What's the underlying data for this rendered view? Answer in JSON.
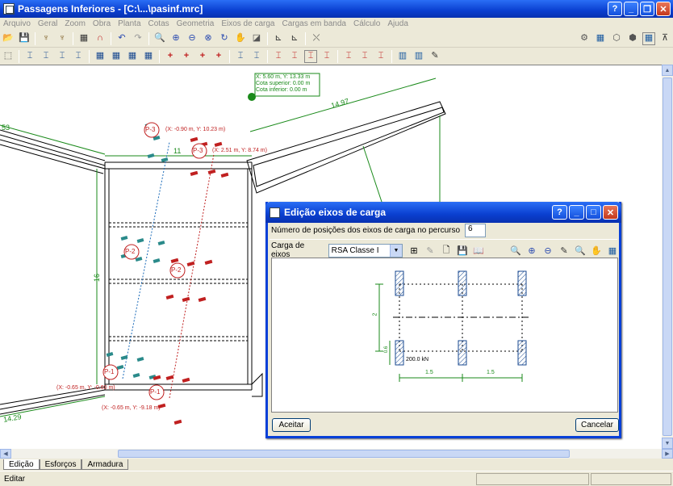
{
  "window": {
    "title": "Passagens Inferiores - [C:\\...\\pasinf.mrc]",
    "help": "?",
    "minimize": "_",
    "restore": "❐",
    "close": "✕"
  },
  "menu": [
    "Arquivo",
    "Geral",
    "Zoom",
    "Obra",
    "Planta",
    "Cotas",
    "Geometria",
    "Eixos de carga",
    "Cargas em banda",
    "Cálculo",
    "Ajuda"
  ],
  "toolbar1": [
    "📂",
    "💾",
    "♆",
    "♆",
    "▦",
    "∩",
    "↶",
    "↷",
    "🔍",
    "⊕",
    "⊖",
    "⊗",
    "↻",
    "✋",
    "◪",
    "⊾",
    "⊾",
    "⤬"
  ],
  "toolbar1_right": [
    "⚙",
    "▦",
    "⬡",
    "⬢",
    "▦",
    "⊼"
  ],
  "toolbar2": [
    "⬚",
    "⌶",
    "⌶",
    "⌶",
    "⌶",
    "▦",
    "▦",
    "▦",
    "▦",
    "+",
    "+",
    "+",
    "+",
    "⌶",
    "⌶",
    "⌶",
    "⌶",
    "⌶",
    "⌶",
    "⌶",
    "⌶",
    "⌶",
    "▥",
    "▥",
    "✎"
  ],
  "drawing": {
    "dim_1497": "14.97",
    "dim_53": "53",
    "dim_11": "11",
    "dim_16": "16",
    "dim_1429": "14.29",
    "tooltip": [
      "X: 5.60 m, Y: 13.33 m",
      "Cota superior: 0.00 m",
      "Cota inferior: 0.00 m"
    ],
    "labels": [
      {
        "id": "P-3",
        "text": "(X: -0.90 m, Y: 10.23 m)"
      },
      {
        "id": "P-3",
        "text": "(X: 2.51 m, Y: 8.74 m)"
      },
      {
        "id": "P-2",
        "text": ""
      },
      {
        "id": "P-2",
        "text": ""
      },
      {
        "id": "P-1",
        "text": "(X: -0.65 m, Y: -9.18 m)"
      },
      {
        "id": "P-1",
        "text": "(X: -0.65 m, Y: -0.60 m)"
      }
    ]
  },
  "dialog": {
    "title": "Edição eixos de carga",
    "positions_label": "Número de posições dos eixos de carga no percurso",
    "positions_value": "6",
    "carga_label": "Carga de eixos",
    "carga_value": "RSA Classe I",
    "icons": [
      "⊞",
      "✎",
      "🗋",
      "💾",
      "📖",
      "🔍",
      "⊕",
      "⊖",
      "✎",
      "🔍",
      "✋",
      "▦"
    ],
    "preview": {
      "load": "200.0 kN",
      "dim_a": "1.5",
      "dim_b": "1.5",
      "dim_v": "2",
      "dim_w": "0.6"
    },
    "accept": "Aceitar",
    "cancel": "Cancelar"
  },
  "tabs": [
    "Edição",
    "Esforços",
    "Armadura"
  ],
  "status": "Editar"
}
